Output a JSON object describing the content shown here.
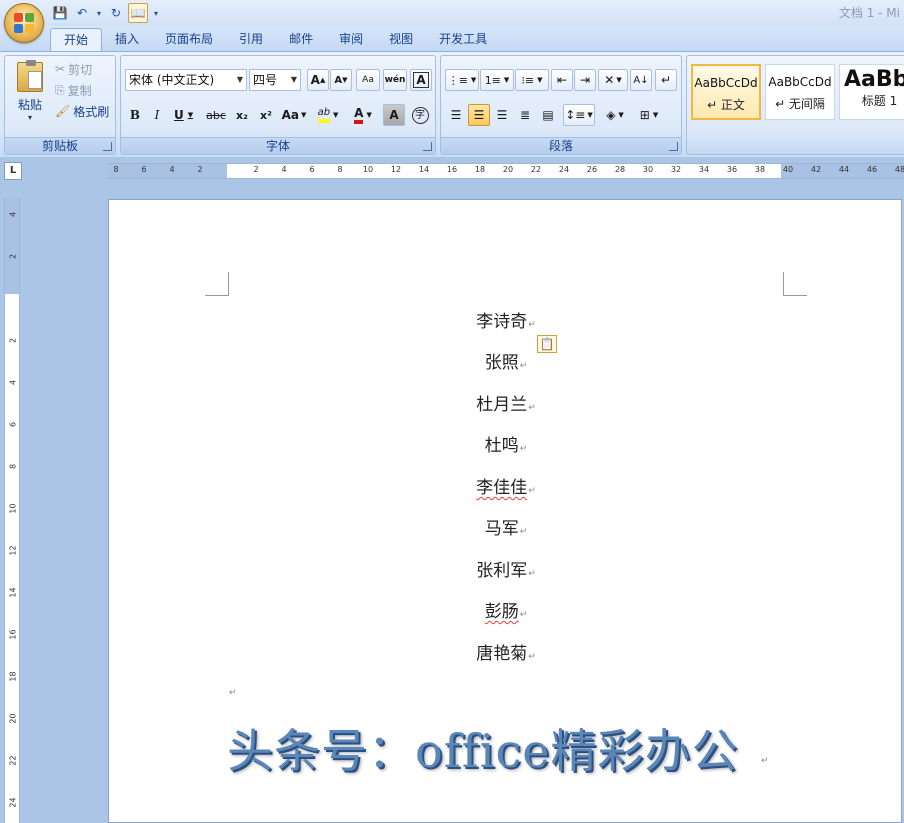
{
  "window_title": "文档 1 - Mi",
  "qat": {
    "save_icon": "💾",
    "undo_icon": "↶",
    "redo_icon": "↻",
    "custom_icon": "📖",
    "more_icon": "▾"
  },
  "tabs": [
    "开始",
    "插入",
    "页面布局",
    "引用",
    "邮件",
    "审阅",
    "视图",
    "开发工具"
  ],
  "clipboard": {
    "paste": "粘贴",
    "cut": "剪切",
    "copy": "复制",
    "format_painter": "格式刷",
    "label": "剪贴板"
  },
  "font": {
    "name": "宋体 (中文正文)",
    "size": "四号",
    "label": "字体",
    "grow": "A",
    "shrink": "A",
    "clear": "Aa",
    "phonetic": "wén",
    "border_char": "A",
    "bold": "B",
    "italic": "I",
    "underline": "U",
    "strike": "abc",
    "sub": "x₂",
    "sup": "x²",
    "case": "Aa",
    "highlight": "ab",
    "color": "A",
    "shading": "A",
    "enclose": "字",
    "highlight_color": "#ffff00",
    "font_color": "#e01010"
  },
  "paragraph": {
    "label": "段落"
  },
  "styles": [
    {
      "sample": "AaBbCcDd",
      "name": "↵ 正文",
      "active": true
    },
    {
      "sample": "AaBbCcDd",
      "name": "↵ 无间隔",
      "active": false
    },
    {
      "sample": "AaBb",
      "name": "标题 1",
      "active": false
    }
  ],
  "ruler": {
    "corner": "L",
    "h_ticks": [
      "8",
      "6",
      "4",
      "2",
      "2",
      "4",
      "6",
      "8",
      "10",
      "12",
      "14",
      "16",
      "18",
      "20",
      "22",
      "24",
      "26",
      "28",
      "30",
      "32",
      "34",
      "36",
      "38",
      "40",
      "42",
      "44",
      "46",
      "48"
    ],
    "v_ticks": [
      "4",
      "2",
      "2",
      "4",
      "6",
      "8",
      "10",
      "12",
      "14",
      "16",
      "18",
      "20",
      "22",
      "24"
    ]
  },
  "document": {
    "names": [
      "李诗奇",
      "张照",
      "杜月兰",
      "杜鸣",
      "李佳佳",
      "马军",
      "张利军",
      "彭肠",
      "唐艳菊"
    ],
    "paragraph_mark": "↵",
    "banner": "头条号：office精彩办公",
    "paste_options_icon": "📋"
  }
}
